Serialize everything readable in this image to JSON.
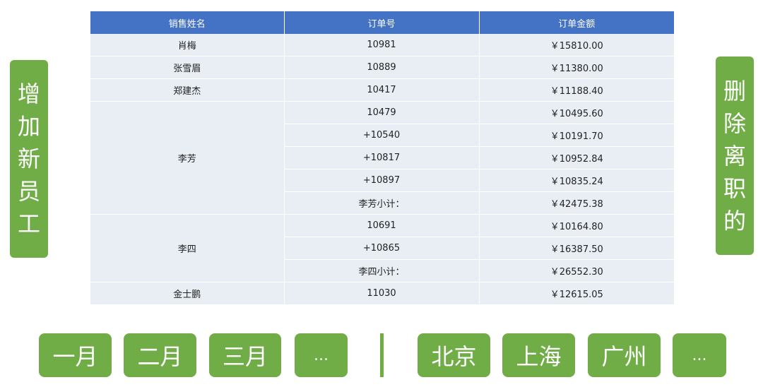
{
  "table": {
    "headers": [
      "销售姓名",
      "订单号",
      "订单金额"
    ],
    "groups": [
      {
        "name": "肖梅",
        "rows": [
          {
            "order": "10981",
            "amount": "￥15810.00"
          }
        ]
      },
      {
        "name": "张雪眉",
        "rows": [
          {
            "order": "10889",
            "amount": "￥11380.00"
          }
        ]
      },
      {
        "name": "郑建杰",
        "rows": [
          {
            "order": "10417",
            "amount": "￥11188.40"
          }
        ]
      },
      {
        "name": "李芳",
        "rows": [
          {
            "order": "10479",
            "amount": "￥10495.60"
          },
          {
            "order": "+10540",
            "amount": "￥10191.70"
          },
          {
            "order": "+10817",
            "amount": "￥10952.84"
          },
          {
            "order": "+10897",
            "amount": "￥10835.24"
          },
          {
            "order": "李芳小计：",
            "amount": "￥42475.38"
          }
        ]
      },
      {
        "name": "李四",
        "rows": [
          {
            "order": "10691",
            "amount": "￥10164.80"
          },
          {
            "order": "+10865",
            "amount": "￥16387.50"
          },
          {
            "order": "李四小计：",
            "amount": "￥26552.30"
          }
        ]
      },
      {
        "name": "金士鹏",
        "rows": [
          {
            "order": "11030",
            "amount": "￥12615.05"
          }
        ]
      }
    ]
  },
  "side_buttons": {
    "add": "增加新员工",
    "remove": "删除离职的"
  },
  "month_filters": [
    "一月",
    "二月",
    "三月",
    "..."
  ],
  "city_filters": [
    "北京",
    "上海",
    "广州",
    "..."
  ],
  "colors": {
    "header_bg": "#4472c4",
    "row_bg": "#e9eef5",
    "button_green": "#70ad47"
  }
}
